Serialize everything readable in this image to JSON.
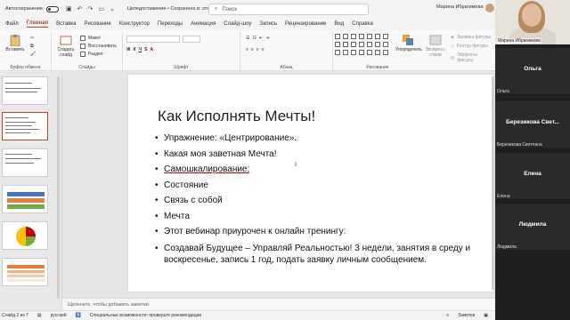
{
  "titlebar": {
    "autosave_label": "Автосохранение",
    "filename": "Целедостижение • Сохранено в: этот компьютер",
    "search_placeholder": "Поиск",
    "user_name": "Марина Ибрагимова"
  },
  "tabs": [
    "Файл",
    "Главная",
    "Вставка",
    "Рисование",
    "Конструктор",
    "Переходы",
    "Анимация",
    "Слайд-шоу",
    "Запись",
    "Рецензирование",
    "Вид",
    "Справка"
  ],
  "active_tab": "Главная",
  "ribbon": {
    "clipboard_label": "Буфер обмена",
    "paste_label": "Вставить",
    "slides_label": "Слайды",
    "new_slide_label": "Создать слайд",
    "layout_label": "Макет",
    "reset_label": "Восстановить",
    "section_label": "Раздел",
    "font_label": "Шрифт",
    "paragraph_label": "Абзац",
    "drawing_label": "Рисование",
    "arrange_label": "Упорядочить",
    "quick_styles_label": "Экспресс-стили",
    "fill_label": "Заливка фигуры",
    "outline_label": "Контур фигуры",
    "effects_label": "Эффекты фигуры"
  },
  "slide": {
    "title": "Как Исполнять Мечты!",
    "bullets": [
      "Упражнение: «Центрирование».",
      "Какая моя  заветная Мечта!",
      "Самошкалирование:",
      "Состояние",
      "Связь с собой",
      "Мечта",
      "Этот вебинар приурочен к онлайн тренингу:",
      "Создавай Будущее – Управляй Реальностью! 3 недели, занятия в среду и воскресенье, запись 1  год, подать заявку личным сообщением."
    ]
  },
  "notes_placeholder": "Щелкните, чтобы добавить заметки",
  "status": {
    "slide_counter": "Слайд 2 из 7",
    "language": "русский",
    "accessibility": "Специальные возможности: проверьте рекомендации",
    "notes_button": "Заметки"
  },
  "video": {
    "presenter_caption": "Марина Ибрагимова",
    "participants": [
      {
        "tile_name": "Ольга",
        "caption": "Ольга"
      },
      {
        "tile_name": "Березикова Свет...",
        "caption": "Березикова Светлана"
      },
      {
        "tile_name": "Елена",
        "caption": "Елена"
      },
      {
        "tile_name": "Людмила",
        "caption": "Людмила"
      }
    ]
  },
  "colors": {
    "accent": "#b7472a",
    "video_bg": "#1f1f1f"
  }
}
